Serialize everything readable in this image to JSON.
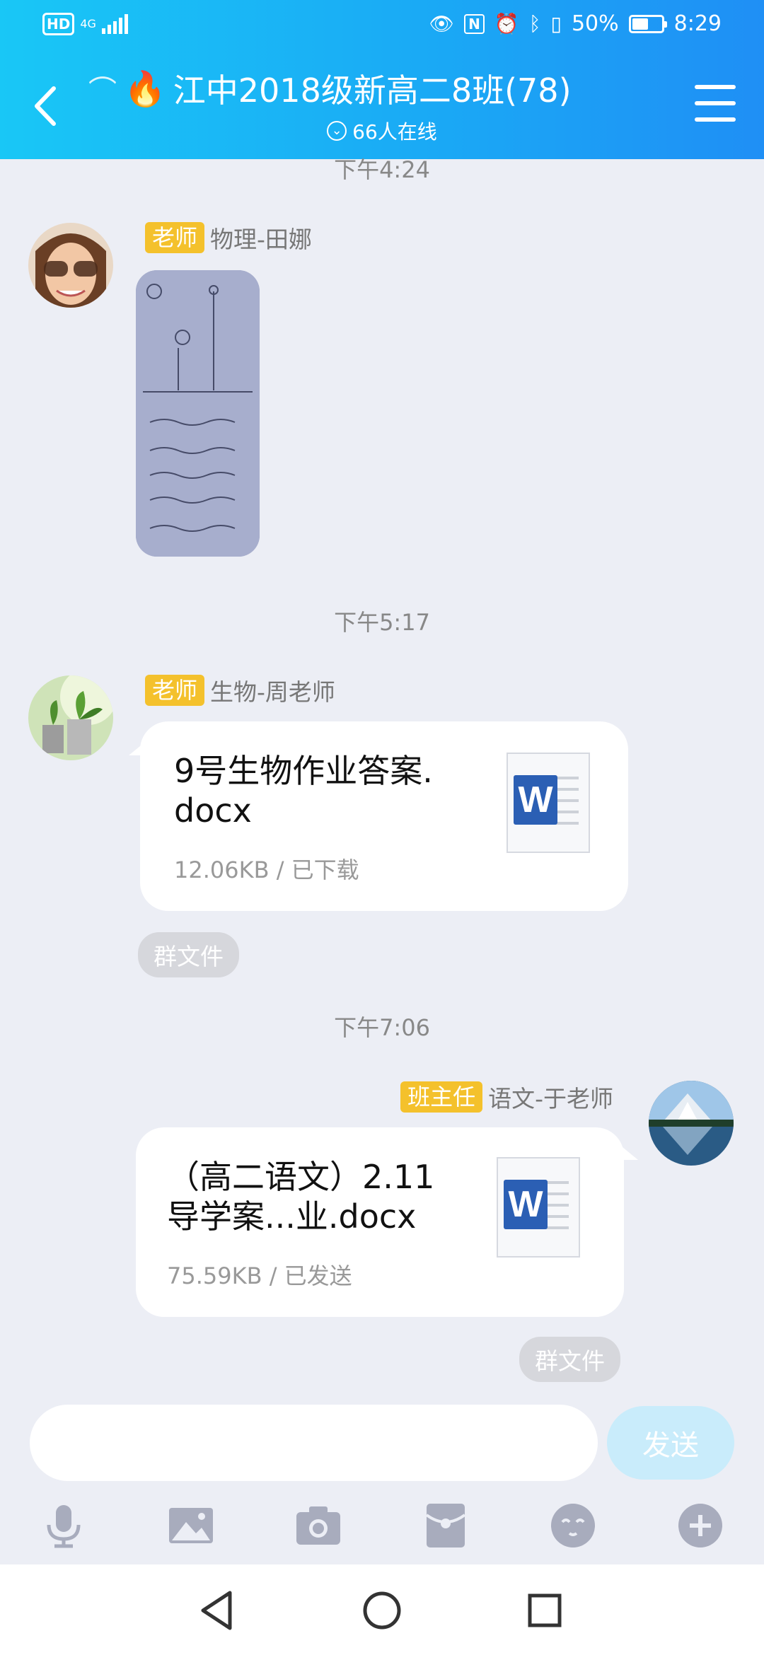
{
  "status_bar": {
    "hd_label": "HD",
    "network_label": "4G",
    "battery": "50%",
    "time": "8:29"
  },
  "header": {
    "title": "江中2018级新高二8班(78)",
    "online": "66人在线"
  },
  "messages": [
    {
      "time": "下午4:24",
      "tag": "老师",
      "sender": "物理-田娜"
    },
    {
      "time": "下午5:17",
      "tag": "老师",
      "sender": "生物-周老师",
      "file_name_line1": "9号生物作业答案.",
      "file_name_line2": "docx",
      "file_meta": "12.06KB / 已下载",
      "chip": "群文件"
    },
    {
      "time": "下午7:06",
      "tag": "班主任",
      "sender": "语文-于老师",
      "file_name_line1": "（高二语文）2.11",
      "file_name_line2": "导学案...业.docx",
      "file_meta": "75.59KB / 已发送",
      "chip": "群文件"
    }
  ],
  "input": {
    "placeholder": "",
    "send_label": "发送"
  },
  "colors": {
    "header_start": "#19c7f6",
    "header_end": "#1f8ff5",
    "tag": "#f4c12c",
    "word_blue": "#2b5fb4",
    "send_disabled": "#c9ecfb"
  }
}
